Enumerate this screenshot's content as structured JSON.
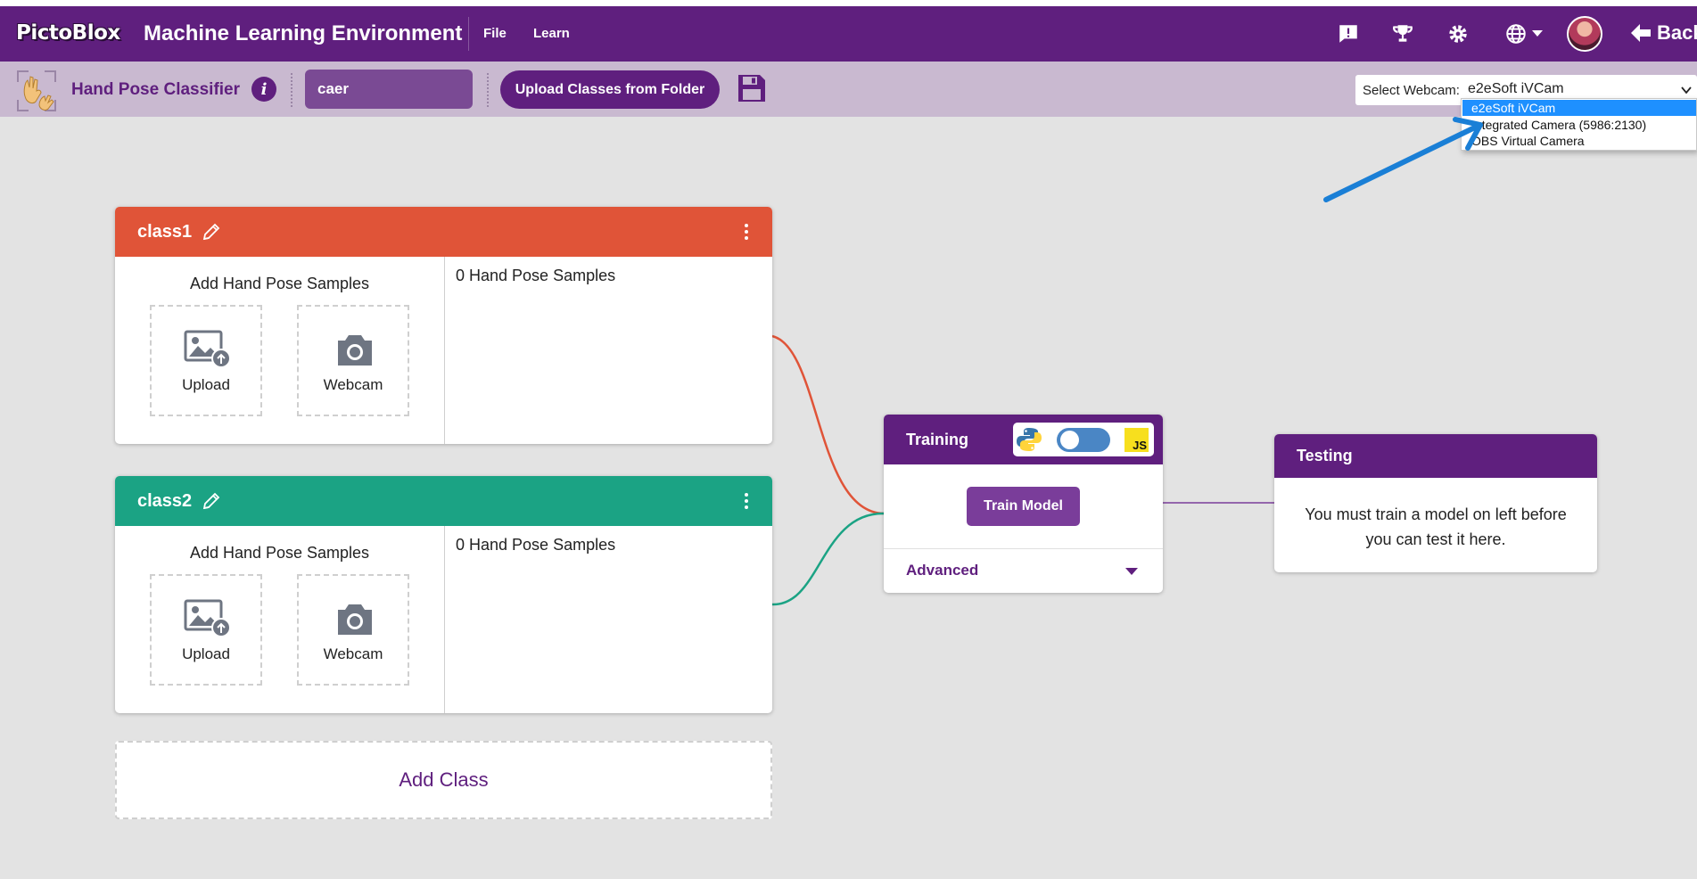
{
  "header": {
    "logo": "PictoBlox",
    "title": "Machine Learning Environment",
    "menu": [
      "File",
      "Learn"
    ],
    "back_label": "Back"
  },
  "subheader": {
    "project_type": "Hand Pose Classifier",
    "info_glyph": "i",
    "project_name": "caer",
    "upload_button": "Upload Classes from Folder",
    "webcam": {
      "label": "Select Webcam:",
      "selected": "e2eSoft iVCam",
      "options": [
        "e2eSoft iVCam",
        "Integrated Camera (5986:2130)",
        "OBS Virtual Camera"
      ]
    }
  },
  "classes": [
    {
      "name": "class1",
      "color": "#e05438",
      "add_label": "Add Hand Pose Samples",
      "upload_label": "Upload",
      "webcam_label": "Webcam",
      "count_label": "0 Hand Pose Samples"
    },
    {
      "name": "class2",
      "color": "#1ba384",
      "add_label": "Add Hand Pose Samples",
      "upload_label": "Upload",
      "webcam_label": "Webcam",
      "count_label": "0 Hand Pose Samples"
    }
  ],
  "add_class_label": "Add Class",
  "training": {
    "title": "Training",
    "train_button": "Train Model",
    "advanced_label": "Advanced",
    "js_label": "JS"
  },
  "testing": {
    "title": "Testing",
    "message": "You must train a model on left before you can test it here."
  },
  "colors": {
    "brand": "#5f1f7e",
    "subheader": "#c9b9d0",
    "annotation_arrow": "#1a7fd6"
  },
  "icons": [
    "feedback-icon",
    "trophy-icon",
    "gear-icon",
    "globe-icon",
    "chevron-down-icon",
    "arrow-left-icon",
    "hand-pose-icon",
    "info-icon",
    "save-icon",
    "pencil-icon",
    "kebab-menu-icon",
    "image-upload-icon",
    "camera-icon",
    "python-icon",
    "caret-down-icon"
  ]
}
